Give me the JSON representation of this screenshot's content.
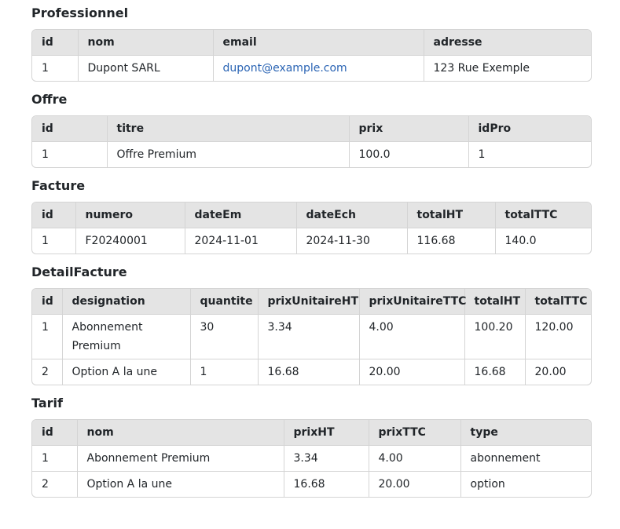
{
  "sections": [
    {
      "title": "Professionnel",
      "headers": [
        "id",
        "nom",
        "email",
        "adresse"
      ],
      "rows": [
        [
          "1",
          "Dupont SARL",
          "dupont@example.com",
          "123 Rue Exemple"
        ]
      ]
    },
    {
      "title": "Offre",
      "headers": [
        "id",
        "titre",
        "prix",
        "idPro"
      ],
      "rows": [
        [
          "1",
          "Offre Premium",
          "100.0",
          "1"
        ]
      ]
    },
    {
      "title": "Facture",
      "headers": [
        "id",
        "numero",
        "dateEm",
        "dateEch",
        "totalHT",
        "totalTTC"
      ],
      "rows": [
        [
          "1",
          "F20240001",
          "2024-11-01",
          "2024-11-30",
          "116.68",
          "140.0"
        ]
      ]
    },
    {
      "title": "DetailFacture",
      "headers": [
        "id",
        "designation",
        "quantite",
        "prixUnitaireHT",
        "prixUnitaireTTC",
        "totalHT",
        "totalTTC"
      ],
      "rows": [
        [
          "1",
          "Abonnement Premium",
          "30",
          "3.34",
          "4.00",
          "100.20",
          "120.00"
        ],
        [
          "2",
          "Option A la une",
          "1",
          "16.68",
          "20.00",
          "16.68",
          "20.00"
        ]
      ]
    },
    {
      "title": "Tarif",
      "headers": [
        "id",
        "nom",
        "prixHT",
        "prixTTC",
        "type"
      ],
      "rows": [
        [
          "1",
          "Abonnement Premium",
          "3.34",
          "4.00",
          "abonnement"
        ],
        [
          "2",
          "Option A la une",
          "16.68",
          "20.00",
          "option"
        ]
      ]
    }
  ],
  "colors": {
    "link": "#2a64b4",
    "header_bg": "#e4e4e4",
    "border": "#d4d4d4"
  }
}
